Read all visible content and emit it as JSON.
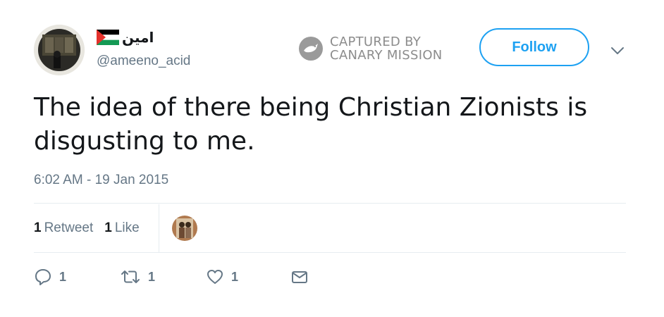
{
  "user": {
    "display_name": "امين",
    "handle": "@ameeno_acid",
    "flag": "palestine-flag-emoji"
  },
  "watermark": {
    "line1": "CAPTURED BY",
    "line2": "CANARY MISSION"
  },
  "follow_label": "Follow",
  "tweet": {
    "text": "The idea of there being Christian Zionists is disgusting to me.",
    "timestamp": "6:02 AM - 19 Jan 2015"
  },
  "stats": {
    "retweet_count": "1",
    "retweet_label": "Retweet",
    "like_count": "1",
    "like_label": "Like"
  },
  "actions": {
    "reply_count": "1",
    "retweet_count": "1",
    "like_count": "1"
  },
  "colors": {
    "accent": "#1da1f2",
    "muted": "#657786",
    "text": "#14171a",
    "divider": "#e6ecf0"
  }
}
